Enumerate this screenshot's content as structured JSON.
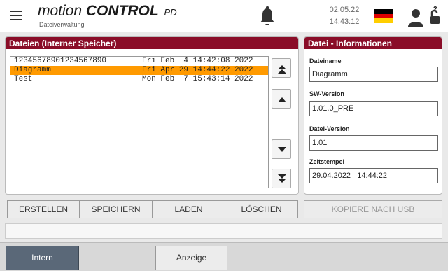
{
  "header": {
    "brand_part1": "motion",
    "brand_part2": "CONTROL",
    "brand_part3": "PD",
    "subtitle": "Dateiverwaltung",
    "date": "02.05.22",
    "time": "14:43:12",
    "user_level": "2"
  },
  "icons": {
    "menu": "hamburger-menu-icon",
    "notifications": "bell-icon",
    "language": "german-flag-icon",
    "user": "user-icon",
    "lock": "unlocked-padlock-icon",
    "scroll_top": "double-chevron-up-icon",
    "scroll_up": "chevron-up-icon",
    "scroll_down": "chevron-down-icon",
    "scroll_bottom": "double-chevron-down-icon"
  },
  "files_panel": {
    "title": "Dateien (Interner Speicher)",
    "files": [
      {
        "name": "12345678901234567890",
        "date": "Fri Feb  4 14:42:08 2022",
        "selected": false
      },
      {
        "name": "Diagramm",
        "date": "Fri Apr 29 14:44:22 2022",
        "selected": true
      },
      {
        "name": "Test",
        "date": "Mon Feb  7 15:43:14 2022",
        "selected": false
      }
    ]
  },
  "info_panel": {
    "title": "Datei - Informationen",
    "fields": [
      {
        "label": "Dateiname",
        "value": "Diagramm"
      },
      {
        "label": "SW-Version",
        "value": "1.01.0_PRE"
      },
      {
        "label": "Datei-Version",
        "value": "1.01"
      },
      {
        "label": "Zeitstempel",
        "value": "29.04.2022   14:44:22"
      }
    ]
  },
  "actions": {
    "create": "ERSTELLEN",
    "save": "SPEICHERN",
    "load": "LADEN",
    "delete": "LÖSCHEN",
    "copy_usb": "KOPIERE NACH USB"
  },
  "bottom_nav": {
    "intern": "Intern",
    "anzeige": "Anzeige"
  },
  "colors": {
    "accent": "#8a0d28",
    "selection": "#ff9a00",
    "active_tab": "#5a6878"
  }
}
